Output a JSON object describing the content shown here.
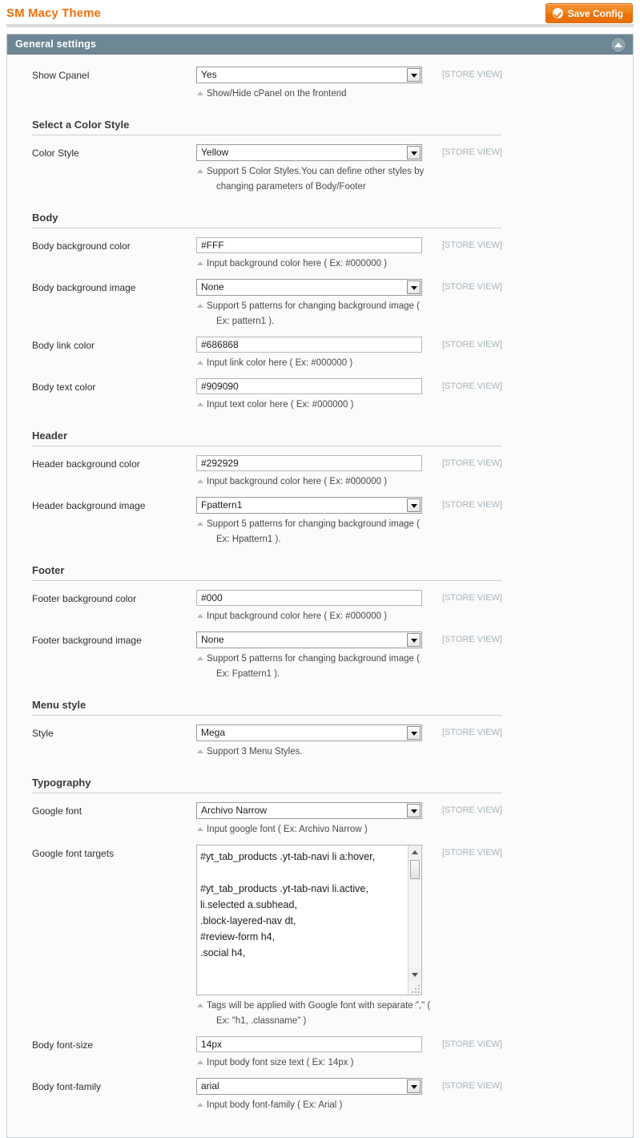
{
  "header": {
    "title": "SM Macy Theme",
    "save_label": "Save Config",
    "save_icon": "check-circle-icon"
  },
  "panel": {
    "title": "General settings",
    "collapse_icon": "caret-up-icon"
  },
  "scope_label": "[STORE VIEW]",
  "colors": {
    "accent_orange": "#ef6e0a",
    "panel_header": "#6e8794",
    "scope_text": "#a6b3bb",
    "page_bg": "#fbfbfb"
  },
  "sections": [
    {
      "heading": null,
      "rows": [
        {
          "label": "Show Cpanel",
          "control": "select",
          "value": "Yes",
          "hint_line1": "Show/Hide cPanel on the frontend",
          "hint_line2": null,
          "scope": "[STORE VIEW]"
        }
      ]
    },
    {
      "heading": "Select a Color Style",
      "rows": [
        {
          "label": "Color Style",
          "control": "select",
          "value": "Yellow",
          "hint_line1": "Support 5 Color Styles.You can define other styles by",
          "hint_line2": "changing parameters of Body/Footer",
          "scope": "[STORE VIEW]"
        }
      ]
    },
    {
      "heading": "Body",
      "rows": [
        {
          "label": "Body background color",
          "control": "text",
          "value": "#FFF",
          "hint_line1": "Input background color here ( Ex: #000000 )",
          "hint_line2": null,
          "scope": "[STORE VIEW]"
        },
        {
          "label": "Body background image",
          "control": "select",
          "value": "None",
          "hint_line1": "Support 5 patterns for changing background image (",
          "hint_line2": "Ex: pattern1 ).",
          "scope": "[STORE VIEW]"
        },
        {
          "label": "Body link color",
          "control": "text",
          "value": "#686868",
          "hint_line1": "Input link color here ( Ex: #000000 )",
          "hint_line2": null,
          "scope": "[STORE VIEW]"
        },
        {
          "label": "Body text color",
          "control": "text",
          "value": "#909090",
          "hint_line1": "Input text color here ( Ex: #000000 )",
          "hint_line2": null,
          "scope": "[STORE VIEW]"
        }
      ]
    },
    {
      "heading": "Header",
      "rows": [
        {
          "label": "Header background color",
          "control": "text",
          "value": "#292929",
          "hint_line1": "Input background color here ( Ex: #000000 )",
          "hint_line2": null,
          "scope": "[STORE VIEW]"
        },
        {
          "label": "Header background image",
          "control": "select",
          "value": "Fpattern1",
          "hint_line1": "Support 5 patterns for changing background image (",
          "hint_line2": "Ex: Hpattern1 ).",
          "scope": "[STORE VIEW]"
        }
      ]
    },
    {
      "heading": "Footer",
      "rows": [
        {
          "label": "Footer background color",
          "control": "text",
          "value": "#000",
          "hint_line1": "Input background color here ( Ex: #000000 )",
          "hint_line2": null,
          "scope": "[STORE VIEW]"
        },
        {
          "label": "Footer background image",
          "control": "select",
          "value": "None",
          "hint_line1": "Support 5 patterns for changing background image (",
          "hint_line2": "Ex: Fpattern1 ).",
          "scope": "[STORE VIEW]"
        }
      ]
    },
    {
      "heading": "Menu style",
      "rows": [
        {
          "label": "Style",
          "control": "select",
          "value": "Mega",
          "hint_line1": "Support 3 Menu Styles.",
          "hint_line2": null,
          "scope": "[STORE VIEW]"
        }
      ]
    },
    {
      "heading": "Typography",
      "rows": [
        {
          "label": "Google font",
          "control": "select",
          "value": "Archivo Narrow",
          "hint_line1": "Input google font ( Ex: Archivo Narrow )",
          "hint_line2": null,
          "scope": "[STORE VIEW]"
        },
        {
          "label": "Google font targets",
          "control": "textarea",
          "value": "#yt_tab_products .yt-tab-navi li a:hover,\n\n#yt_tab_products .yt-tab-navi li.active,                                    li.selected a.subhead,                                    .block-layered-nav dt,                                    #review-form h4,                                    .social h4,",
          "hint_line1": "Tags will be applied with Google font with separate \",\" (",
          "hint_line2": "Ex: \"h1, .classname\" )",
          "scope": "[STORE VIEW]"
        },
        {
          "label": "Body font-size",
          "control": "text",
          "value": "14px",
          "hint_line1": "Input body font size text ( Ex: 14px )",
          "hint_line2": null,
          "scope": "[STORE VIEW]"
        },
        {
          "label": "Body font-family",
          "control": "select",
          "value": "arial",
          "hint_line1": "Input body font-family ( Ex: Arial )",
          "hint_line2": null,
          "scope": "[STORE VIEW]"
        }
      ]
    }
  ]
}
